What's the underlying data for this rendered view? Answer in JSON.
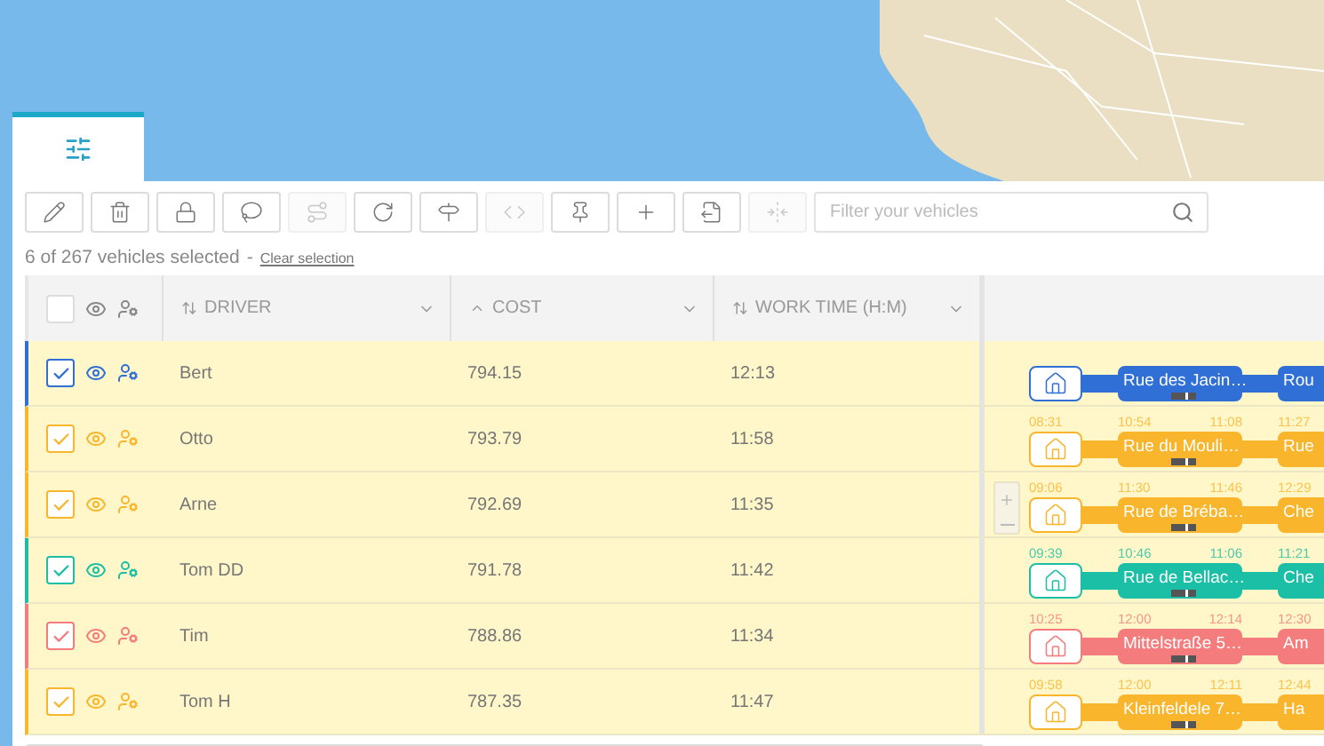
{
  "tab": {
    "kind": "filters",
    "selected": true
  },
  "toolbar": [
    {
      "kind": "edit",
      "disabled": false
    },
    {
      "kind": "delete",
      "disabled": false
    },
    {
      "kind": "lock",
      "disabled": false
    },
    {
      "kind": "lasso",
      "disabled": false
    },
    {
      "kind": "route",
      "disabled": true
    },
    {
      "kind": "refresh",
      "disabled": false
    },
    {
      "kind": "signpost",
      "disabled": false
    },
    {
      "kind": "code",
      "disabled": true
    },
    {
      "kind": "pin",
      "disabled": false
    },
    {
      "kind": "add",
      "disabled": false
    },
    {
      "kind": "export",
      "disabled": false
    },
    {
      "kind": "collapse",
      "disabled": true
    }
  ],
  "filter": {
    "placeholder": "Filter your vehicles"
  },
  "selection": {
    "summary": "6 of 267 vehicles selected",
    "separator": "-",
    "clear_link": "Clear selection"
  },
  "table": {
    "header_checked": false,
    "columns": [
      {
        "label": "DRIVER",
        "kind": "sortable"
      },
      {
        "label": "COST",
        "kind": "sorted-up"
      },
      {
        "label": "WORK TIME (H:M)",
        "kind": "sortable"
      }
    ],
    "rows": [
      {
        "driver": "Bert",
        "cost": "794.15",
        "work_time": "12:13",
        "checked": true,
        "color": "#2f6fd6",
        "stops": [
          "Rue des Jacin…",
          "Rou"
        ]
      },
      {
        "driver": "Otto",
        "cost": "793.79",
        "work_time": "11:58",
        "checked": true,
        "color": "#f9b52c",
        "times": [
          "08:31",
          "10:54",
          "11:08",
          "11:27"
        ],
        "stops": [
          "Rue du Mouli…",
          "Rue"
        ]
      },
      {
        "driver": "Arne",
        "cost": "792.69",
        "work_time": "11:35",
        "checked": true,
        "color": "#f9b52c",
        "times": [
          "09:06",
          "11:30",
          "11:46",
          "12:29"
        ],
        "stops": [
          "Rue de Bréba…",
          "Che"
        ]
      },
      {
        "driver": "Tom DD",
        "cost": "791.78",
        "work_time": "11:42",
        "checked": true,
        "color": "#1bbfa6",
        "times": [
          "09:39",
          "10:46",
          "11:06",
          "11:21"
        ],
        "stops": [
          "Rue de Bellac…",
          "Che"
        ]
      },
      {
        "driver": "Tim",
        "cost": "788.86",
        "work_time": "11:34",
        "checked": true,
        "color": "#f47c7c",
        "times": [
          "10:25",
          "12:00",
          "12:14",
          "12:30"
        ],
        "stops": [
          "Mittelstraße 5…",
          "Am"
        ]
      },
      {
        "driver": "Tom H",
        "cost": "787.35",
        "work_time": "11:47",
        "checked": true,
        "color": "#f9b52c",
        "times": [
          "09:58",
          "12:00",
          "12:11",
          "12:44"
        ],
        "stops": [
          "Kleinfeldele 7…",
          "Ha"
        ]
      }
    ]
  }
}
